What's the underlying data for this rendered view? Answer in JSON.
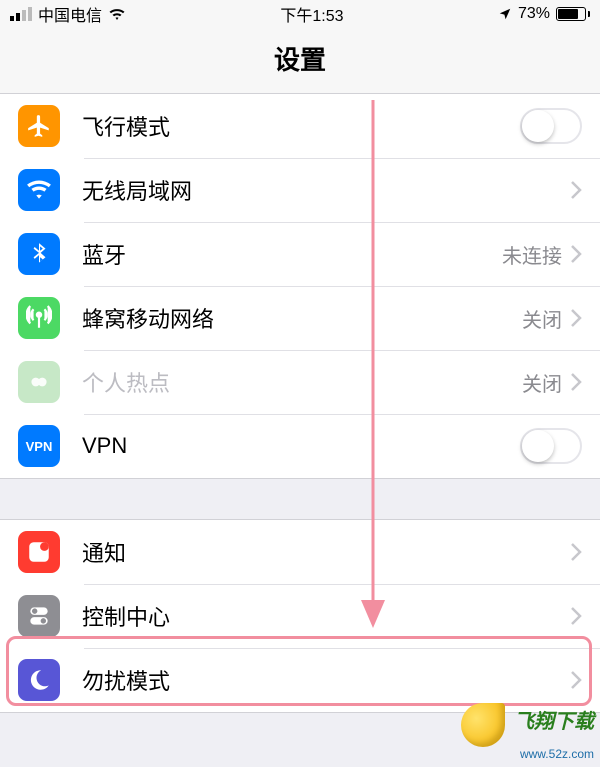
{
  "status": {
    "carrier": "中国电信",
    "time": "下午1:53",
    "battery_pct": "73%"
  },
  "nav": {
    "title": "设置"
  },
  "group1": {
    "airplane": "飞行模式",
    "wifi": "无线局域网",
    "bluetooth": "蓝牙",
    "bluetooth_value": "未连接",
    "cellular": "蜂窝移动网络",
    "cellular_value": "关闭",
    "hotspot": "个人热点",
    "hotspot_value": "关闭",
    "vpn_label": "VPN",
    "vpn_badge": "VPN"
  },
  "group2": {
    "notifications": "通知",
    "control_center": "控制中心",
    "dnd": "勿扰模式"
  },
  "watermark": {
    "brand": "飞翔下载",
    "url": "www.52z.com"
  }
}
